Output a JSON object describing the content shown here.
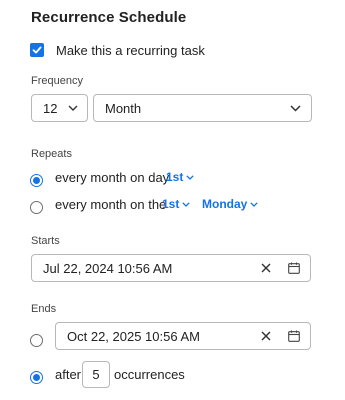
{
  "title": "Recurrence Schedule",
  "recurring": {
    "label": "Make this a recurring task",
    "checked": true
  },
  "frequency": {
    "label": "Frequency",
    "interval": "12",
    "unit": "Month"
  },
  "repeats": {
    "label": "Repeats",
    "option1": {
      "text": "every month on day",
      "day": "1st",
      "selected": true
    },
    "option2": {
      "text": "every month on the",
      "ordinal": "1st",
      "weekday": "Monday",
      "selected": false
    }
  },
  "starts": {
    "label": "Starts",
    "value": "Jul 22, 2024 10:56 AM"
  },
  "ends": {
    "label": "Ends",
    "date_option": {
      "value": "Oct 22, 2025 10:56 AM",
      "selected": false
    },
    "after_option": {
      "prefix": "after",
      "count": "5",
      "suffix": "occurrences",
      "selected": true
    }
  },
  "icons": {
    "clear": "close-icon",
    "calendar": "calendar-icon",
    "dropdown": "chevron-down-icon",
    "check": "checkmark-icon"
  },
  "colors": {
    "accent": "#1473e6",
    "border": "#b8b8b8",
    "text": "#222222"
  }
}
